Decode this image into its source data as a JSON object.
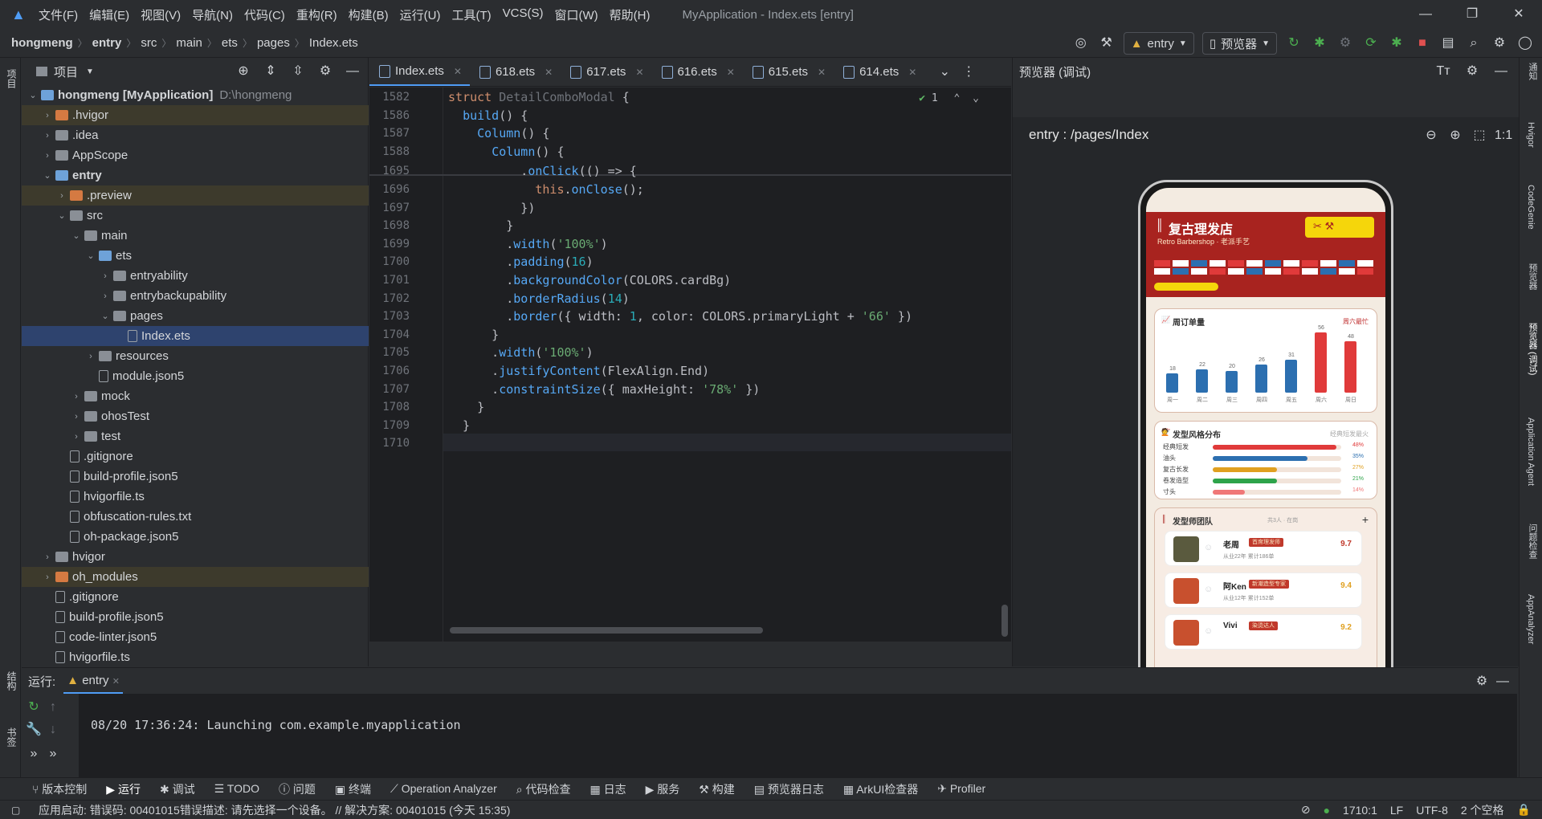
{
  "titlebar": {
    "menu": [
      "文件(F)",
      "编辑(E)",
      "视图(V)",
      "导航(N)",
      "代码(C)",
      "重构(R)",
      "构建(B)",
      "运行(U)",
      "工具(T)",
      "VCS(S)",
      "窗口(W)",
      "帮助(H)"
    ],
    "window_title": "MyApplication - Index.ets [entry]"
  },
  "breadcrumb": [
    "hongmeng",
    "entry",
    "src",
    "main",
    "ets",
    "pages",
    "Index.ets"
  ],
  "toolbar": {
    "module": "entry",
    "device": "预览器"
  },
  "project": {
    "title": "项目",
    "root_name": "hongmeng [MyApplication]",
    "root_path": "D:\\hongmeng",
    "items": [
      {
        "label": ".hvigor",
        "depth": 1,
        "kind": "fold-o",
        "arrow": "›",
        "excluded": true
      },
      {
        "label": ".idea",
        "depth": 1,
        "kind": "fold",
        "arrow": "›"
      },
      {
        "label": "AppScope",
        "depth": 1,
        "kind": "fold",
        "arrow": "›"
      },
      {
        "label": "entry",
        "depth": 1,
        "kind": "fold-b",
        "arrow": "⌄",
        "bold": true
      },
      {
        "label": ".preview",
        "depth": 2,
        "kind": "fold-o",
        "arrow": "›",
        "excluded": true
      },
      {
        "label": "src",
        "depth": 2,
        "kind": "fold",
        "arrow": "⌄"
      },
      {
        "label": "main",
        "depth": 3,
        "kind": "fold",
        "arrow": "⌄"
      },
      {
        "label": "ets",
        "depth": 4,
        "kind": "fold-b",
        "arrow": "⌄"
      },
      {
        "label": "entryability",
        "depth": 5,
        "kind": "fold",
        "arrow": "›"
      },
      {
        "label": "entrybackupability",
        "depth": 5,
        "kind": "fold",
        "arrow": "›"
      },
      {
        "label": "pages",
        "depth": 5,
        "kind": "fold",
        "arrow": "⌄"
      },
      {
        "label": "Index.ets",
        "depth": 6,
        "kind": "file",
        "arrow": "",
        "selected": true
      },
      {
        "label": "resources",
        "depth": 4,
        "kind": "fold",
        "arrow": "›"
      },
      {
        "label": "module.json5",
        "depth": 4,
        "kind": "file",
        "arrow": ""
      },
      {
        "label": "mock",
        "depth": 3,
        "kind": "fold",
        "arrow": "›"
      },
      {
        "label": "ohosTest",
        "depth": 3,
        "kind": "fold",
        "arrow": "›"
      },
      {
        "label": "test",
        "depth": 3,
        "kind": "fold",
        "arrow": "›"
      },
      {
        "label": ".gitignore",
        "depth": 2,
        "kind": "file",
        "arrow": ""
      },
      {
        "label": "build-profile.json5",
        "depth": 2,
        "kind": "file",
        "arrow": ""
      },
      {
        "label": "hvigorfile.ts",
        "depth": 2,
        "kind": "file",
        "arrow": ""
      },
      {
        "label": "obfuscation-rules.txt",
        "depth": 2,
        "kind": "file",
        "arrow": ""
      },
      {
        "label": "oh-package.json5",
        "depth": 2,
        "kind": "file",
        "arrow": ""
      },
      {
        "label": "hvigor",
        "depth": 1,
        "kind": "fold",
        "arrow": "›"
      },
      {
        "label": "oh_modules",
        "depth": 1,
        "kind": "fold-o",
        "arrow": "›",
        "excluded": true
      },
      {
        "label": ".gitignore",
        "depth": 1,
        "kind": "file",
        "arrow": ""
      },
      {
        "label": "build-profile.json5",
        "depth": 1,
        "kind": "file",
        "arrow": ""
      },
      {
        "label": "code-linter.json5",
        "depth": 1,
        "kind": "file",
        "arrow": ""
      },
      {
        "label": "hvigorfile.ts",
        "depth": 1,
        "kind": "file",
        "arrow": ""
      }
    ]
  },
  "editor": {
    "tabs": [
      "Index.ets",
      "618.ets",
      "617.ets",
      "616.ets",
      "615.ets",
      "614.ets"
    ],
    "inspection_count": "1",
    "lines": [
      {
        "n": "1582",
        "html": "<span class='kw'>struct</span> <span class='ty' style='color:#6f737a'>DetailComboModal</span> {"
      },
      {
        "n": "1586",
        "html": "  <span class='fn'>build</span>() {"
      },
      {
        "n": "1587",
        "html": "    <span class='fn'>Column</span>() {"
      },
      {
        "n": "1588",
        "html": "      <span class='fn'>Column</span>() {"
      },
      {
        "n": "1695",
        "html": "          .<span class='fn'>onClick</span>(() => {"
      },
      {
        "n": "1696",
        "html": "            <span class='kw'>this</span>.<span class='fn'>onClose</span>();"
      },
      {
        "n": "1697",
        "html": "          })"
      },
      {
        "n": "1698",
        "html": "        }"
      },
      {
        "n": "1699",
        "html": "        .<span class='fn'>width</span>(<span class='str'>'100%'</span>)"
      },
      {
        "n": "1700",
        "html": "        .<span class='fn'>padding</span>(<span class='num'>16</span>)"
      },
      {
        "n": "1701",
        "html": "        .<span class='fn'>backgroundColor</span>(COLORS.cardBg)"
      },
      {
        "n": "1702",
        "html": "        .<span class='fn'>borderRadius</span>(<span class='num'>14</span>)"
      },
      {
        "n": "1703",
        "html": "        .<span class='fn'>border</span>({ width: <span class='num'>1</span>, color: COLORS.primaryLight + <span class='str'>'66'</span> })"
      },
      {
        "n": "1704",
        "html": "      }"
      },
      {
        "n": "1705",
        "html": "      .<span class='fn'>width</span>(<span class='str'>'100%'</span>)"
      },
      {
        "n": "1706",
        "html": "      .<span class='fn'>justifyContent</span>(FlexAlign.End)"
      },
      {
        "n": "1707",
        "html": "      .<span class='fn'>constraintSize</span>({ maxHeight: <span class='str'>'78%'</span> })"
      },
      {
        "n": "1708",
        "html": "    }"
      },
      {
        "n": "1709",
        "html": "  }"
      },
      {
        "n": "1710",
        "html": ""
      }
    ]
  },
  "preview": {
    "title": "预览器 (调试)",
    "path": "entry : /pages/Index",
    "app": {
      "title": "复古理发店",
      "subtitle": "Retro Barbershop · 老派手艺",
      "weekly_card": {
        "title": "周订单量",
        "right": "周六最忙"
      },
      "weekly_chart": {
        "type": "bar",
        "categories": [
          "周一",
          "周二",
          "周三",
          "周四",
          "周五",
          "周六",
          "周日"
        ],
        "values": [
          18,
          22,
          20,
          26,
          31,
          56,
          48
        ],
        "colors": [
          "#2c6fb0",
          "#2c6fb0",
          "#2c6fb0",
          "#2c6fb0",
          "#2c6fb0",
          "#e03a3a",
          "#e03a3a"
        ]
      },
      "style_card": {
        "title": "发型风格分布",
        "right": "经典短发最火"
      },
      "styles": [
        {
          "name": "经典短发",
          "pct": "48%",
          "value": 0.96,
          "color": "#e03a3a"
        },
        {
          "name": "油头",
          "pct": "35%",
          "value": 0.74,
          "color": "#2c6fb0"
        },
        {
          "name": "复古长发",
          "pct": "27%",
          "value": 0.5,
          "color": "#e0a020"
        },
        {
          "name": "卷发造型",
          "pct": "21%",
          "value": 0.5,
          "color": "#2ea34a"
        },
        {
          "name": "寸头",
          "pct": "14%",
          "value": 0.25,
          "color": "#f07878"
        }
      ],
      "team_card": {
        "title": "发型师团队",
        "right": "共3人 · 在岗"
      },
      "barbers": [
        {
          "name": "老周",
          "tag": "首席理发师",
          "sub": "从业22年  累计186单",
          "score": "9.7",
          "color": "#5a5a3e"
        },
        {
          "name": "阿Ken",
          "tag": "新潮造型专家",
          "sub": "从业12年  累计152单",
          "score": "9.4",
          "color": "#c8502e"
        },
        {
          "name": "Vivi",
          "tag": "染烫达人",
          "sub": "",
          "score": "9.2",
          "color": "#c8502e"
        }
      ]
    }
  },
  "run": {
    "label": "运行:",
    "config": "entry",
    "console": "08/20 17:36:24: Launching com.example.myapplication"
  },
  "tool_tabs": [
    "版本控制",
    "运行",
    "调试",
    "TODO",
    "问题",
    "终端",
    "Operation Analyzer",
    "代码检查",
    "日志",
    "服务",
    "构建",
    "预览器日志",
    "ArkUI检查器",
    "Profiler"
  ],
  "status": {
    "message": "应用启动: 错误码: 00401015错误描述: 请先选择一个设备。 // 解决方案: 00401015 (今天 15:35)",
    "position": "1710:1",
    "line_sep": "LF",
    "encoding": "UTF-8",
    "indent": "2 个空格"
  },
  "right_strip": [
    "通知",
    "Hvigor",
    "CodeGenie",
    "预览器",
    "预览器 (调试)",
    "Application Agent",
    "问题检查",
    "AppAnalyzer"
  ],
  "left_strip": [
    "项目",
    "结构",
    "书签"
  ]
}
